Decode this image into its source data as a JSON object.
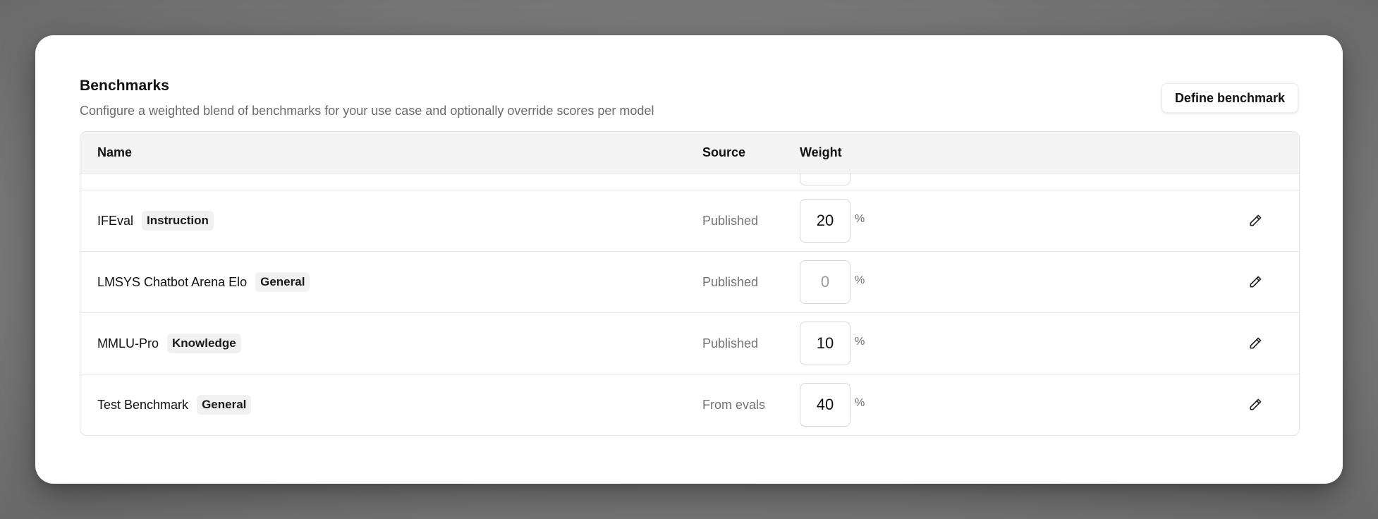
{
  "header": {
    "title": "Benchmarks",
    "subtitle": "Configure a weighted blend of benchmarks for your use case and optionally override scores per model",
    "define_button": "Define benchmark"
  },
  "table": {
    "columns": {
      "name": "Name",
      "source": "Source",
      "weight": "Weight"
    },
    "percent_sign": "%",
    "rows": [
      {
        "name": "IFEval",
        "tag": "Instruction",
        "source": "Published",
        "weight": "20",
        "weight_placeholder": "0"
      },
      {
        "name": "LMSYS Chatbot Arena Elo",
        "tag": "General",
        "source": "Published",
        "weight": "",
        "weight_placeholder": "0"
      },
      {
        "name": "MMLU-Pro",
        "tag": "Knowledge",
        "source": "Published",
        "weight": "10",
        "weight_placeholder": "0"
      },
      {
        "name": "Test Benchmark",
        "tag": "General",
        "source": "From evals",
        "weight": "40",
        "weight_placeholder": "0"
      }
    ]
  },
  "icons": {
    "edit": "pencil-icon"
  }
}
